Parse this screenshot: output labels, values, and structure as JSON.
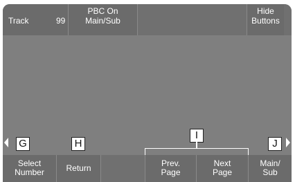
{
  "top_bar": {
    "track_label": "Track",
    "track_number": "99",
    "pbc_line1": "PBC On",
    "pbc_line2": "Main/Sub",
    "hide_line1": "Hide",
    "hide_line2": "Buttons"
  },
  "bottom_bar": {
    "select_line1": "Select",
    "select_line2": "Number",
    "return": "Return",
    "prev_line1": "Prev.",
    "prev_line2": "Page",
    "next_line1": "Next",
    "next_line2": "Page",
    "mainsub_line1": "Main/",
    "mainsub_line2": "Sub"
  },
  "callouts": {
    "g": "G",
    "h": "H",
    "i": "I",
    "j": "J"
  },
  "icons": {
    "left": "chevron-left-icon",
    "right": "chevron-right-icon"
  }
}
